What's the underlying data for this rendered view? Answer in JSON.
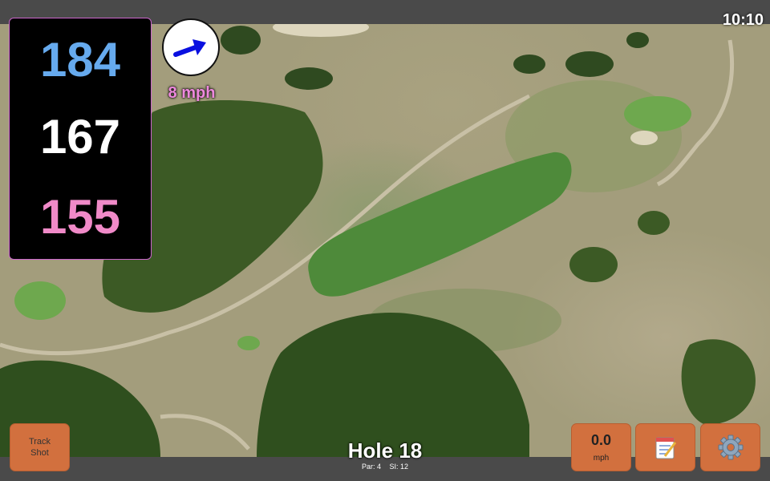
{
  "status": {
    "time": "10:10"
  },
  "distances": {
    "back": "184",
    "middle": "167",
    "front": "155"
  },
  "wind": {
    "speed_label": "8 mph",
    "direction_icon": "wind-arrow-icon"
  },
  "hole": {
    "title": "Hole 18",
    "par": "Par: 4",
    "stroke_index": "SI: 12"
  },
  "buttons": {
    "track_line1": "Track",
    "track_line2": "Shot",
    "wind_value": "0.0",
    "wind_unit": "mph",
    "notes_icon": "notepad-icon",
    "settings_icon": "gear-icon"
  },
  "colors": {
    "back_distance": "#66aaee",
    "middle_distance": "#ffffff",
    "front_distance": "#f08ac8",
    "button": "#d2703e",
    "wind_arrow": "#0a10e0"
  }
}
